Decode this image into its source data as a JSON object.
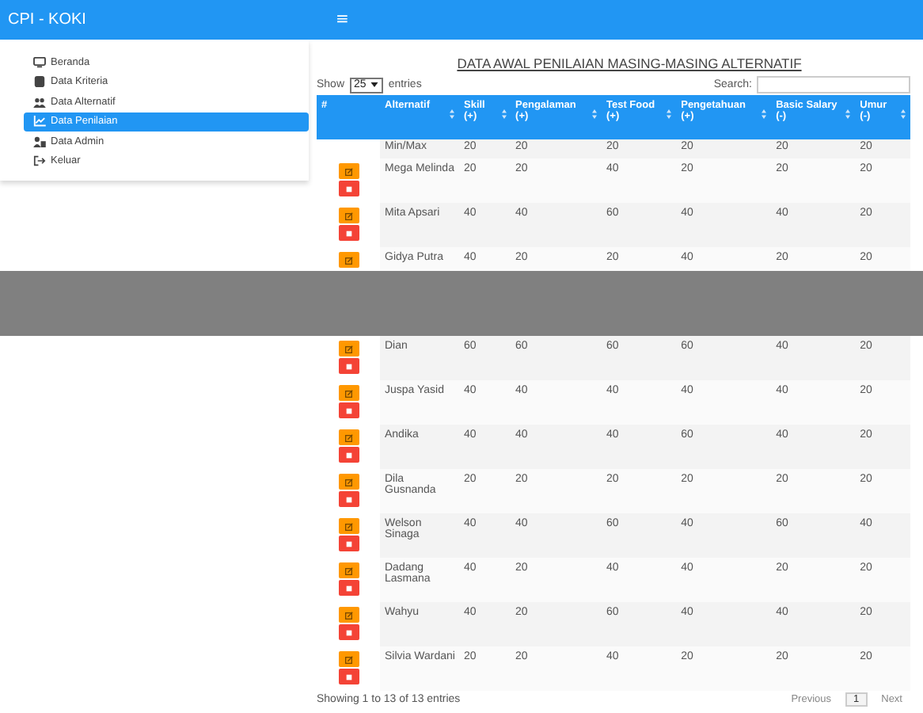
{
  "app_title": "CPI - KOKI",
  "menu_button": "≡",
  "sidebar": {
    "items": [
      {
        "label": "Beranda",
        "selected": false
      },
      {
        "label": "Data Kriteria",
        "selected": false
      },
      {
        "label": "Data Alternatif",
        "selected": false
      },
      {
        "label": "Data Penilaian",
        "selected": true
      },
      {
        "label": "Data Admin",
        "selected": false
      },
      {
        "label": "Keluar",
        "selected": false
      }
    ]
  },
  "page_title": "DATA AWAL PENILAIAN MASING-MASING ALTERNATIF",
  "length_control": {
    "before": "Show",
    "value": "25",
    "after": "entries"
  },
  "search": {
    "label": "Search:"
  },
  "table": {
    "columns": [
      "#",
      "Alternatif",
      "Skill (+)",
      "Pengalaman (+)",
      "Test Food (+)",
      "Pengetahuan (+)",
      "Basic Salary (-)",
      "Umur (-)"
    ],
    "rows": [
      {
        "kind": "minmax",
        "name": "Min/Max",
        "values": [
          "20",
          "20",
          "20",
          "20",
          "20",
          "20"
        ]
      },
      {
        "kind": "entry",
        "name": "Mega Melinda",
        "values": [
          "20",
          "20",
          "40",
          "20",
          "20",
          "20"
        ]
      },
      {
        "kind": "entry",
        "name": "Mita Apsari",
        "values": [
          "40",
          "40",
          "60",
          "40",
          "40",
          "20"
        ]
      },
      {
        "kind": "partial",
        "name": "Gidya Putra",
        "values": [
          "40",
          "20",
          "20",
          "40",
          "20",
          "20"
        ]
      },
      {
        "kind": "entry",
        "name": "Dian",
        "values": [
          "60",
          "60",
          "60",
          "60",
          "40",
          "20"
        ]
      },
      {
        "kind": "entry",
        "name": "Juspa Yasid",
        "values": [
          "40",
          "40",
          "40",
          "40",
          "40",
          "20"
        ]
      },
      {
        "kind": "entry",
        "name": "Andika",
        "values": [
          "40",
          "40",
          "40",
          "60",
          "40",
          "20"
        ]
      },
      {
        "kind": "entry",
        "name": "Dila Gusnanda",
        "values": [
          "20",
          "20",
          "20",
          "20",
          "20",
          "20"
        ]
      },
      {
        "kind": "entry",
        "name": "Welson Sinaga",
        "values": [
          "40",
          "40",
          "60",
          "40",
          "60",
          "40"
        ]
      },
      {
        "kind": "entry",
        "name": "Dadang Lasmana",
        "values": [
          "40",
          "20",
          "40",
          "40",
          "20",
          "20"
        ]
      },
      {
        "kind": "entry",
        "name": "Wahyu",
        "values": [
          "40",
          "20",
          "60",
          "40",
          "40",
          "20"
        ]
      },
      {
        "kind": "entry",
        "name": "Silvia Wardani",
        "values": [
          "20",
          "20",
          "40",
          "20",
          "20",
          "20"
        ]
      }
    ]
  },
  "info": "Showing 1 to 13 of 13 entries",
  "pagination": {
    "previous": "Previous",
    "pages": [
      {
        "label": "1",
        "selected": true
      }
    ],
    "next": "Next"
  }
}
